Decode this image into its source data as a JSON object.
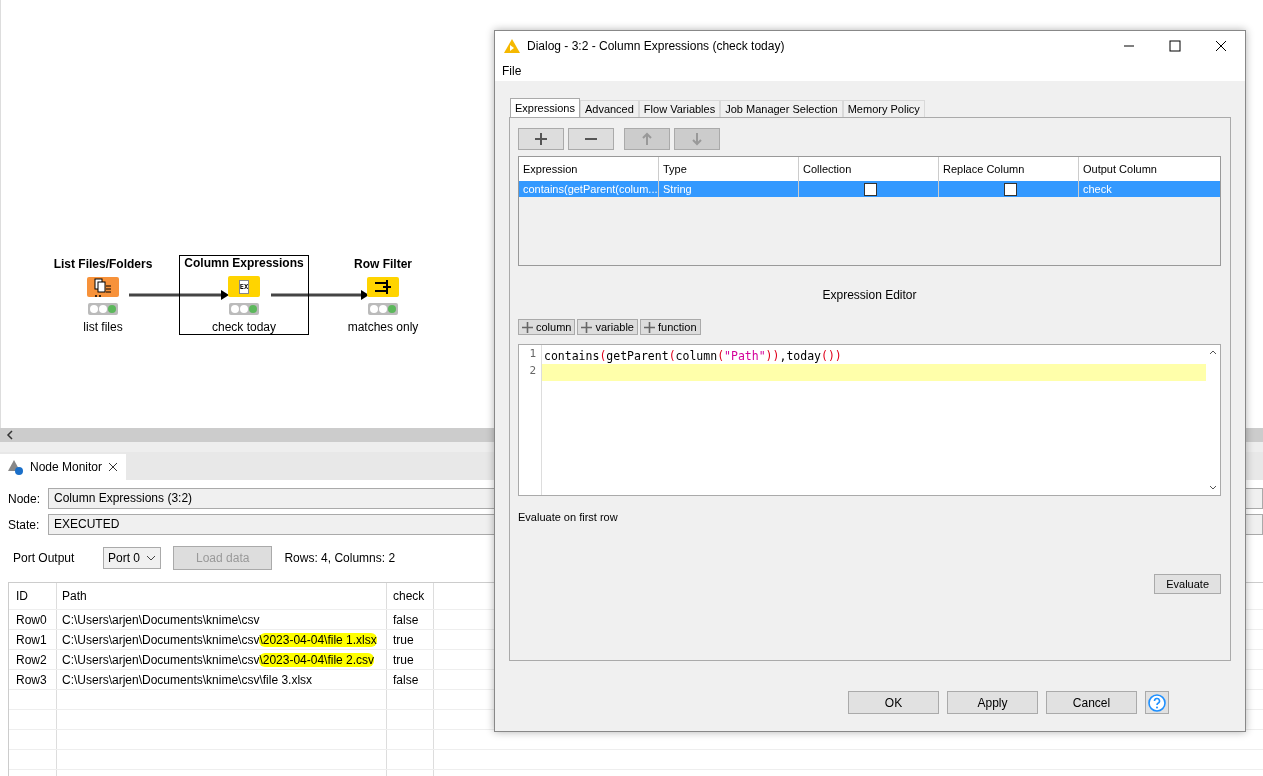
{
  "workflow": {
    "nodes": [
      {
        "title": "List Files/Folders",
        "label": "list files",
        "kind": "reader",
        "executed": true,
        "selected": false
      },
      {
        "title": "Column Expressions",
        "label": "check today",
        "kind": "manipulator",
        "executed": true,
        "selected": true,
        "badge": "EX"
      },
      {
        "title": "Row Filter",
        "label": "matches only",
        "kind": "filter",
        "executed": true,
        "selected": false
      }
    ]
  },
  "node_monitor": {
    "tab": "Node Monitor",
    "node_label": "Node:",
    "node_value": "Column Expressions  (3:2)",
    "state_label": "State:",
    "state_value": "EXECUTED",
    "port_label": "Port Output",
    "port_value": "Port 0",
    "load_button": "Load data",
    "load_disabled": true,
    "summary": "Rows: 4, Columns: 2",
    "table": {
      "columns": [
        "ID",
        "Path",
        "check"
      ],
      "rows": [
        {
          "id": "Row0",
          "path": "C:\\Users\\arjen\\Documents\\knime\\csv",
          "highlighted": "",
          "check": "false"
        },
        {
          "id": "Row1",
          "path": "C:\\Users\\arjen\\Documents\\knime\\csv",
          "highlighted": "\\2023-04-04\\file 1.xlsx",
          "check": "true"
        },
        {
          "id": "Row2",
          "path": "C:\\Users\\arjen\\Documents\\knime\\csv",
          "highlighted": "\\2023-04-04\\file 2.csv",
          "check": "true"
        },
        {
          "id": "Row3",
          "path": "C:\\Users\\arjen\\Documents\\knime\\csv\\file 3.xlsx",
          "highlighted": "",
          "check": "false"
        }
      ]
    }
  },
  "dialog": {
    "title": "Dialog - 3:2 - Column Expressions (check today)",
    "menu": [
      "File"
    ],
    "tabs": [
      {
        "label": "Expressions",
        "selected": true
      },
      {
        "label": "Advanced",
        "selected": false
      },
      {
        "label": "Flow Variables",
        "selected": false
      },
      {
        "label": "Job Manager Selection",
        "selected": false
      },
      {
        "label": "Memory Policy",
        "selected": false
      }
    ],
    "toolbar": [
      {
        "kind": "add",
        "disabled": false
      },
      {
        "kind": "remove",
        "disabled": false
      },
      {
        "kind": "up",
        "disabled": true
      },
      {
        "kind": "down",
        "disabled": true
      }
    ],
    "table": {
      "columns": [
        "Expression",
        "Type",
        "Collection",
        "Replace Column",
        "Output Column"
      ],
      "rows": [
        {
          "expression": "contains(getParent(colum...",
          "type": "String",
          "collection": false,
          "replace": false,
          "output": "check",
          "selected": true
        }
      ]
    },
    "editor_title": "Expression Editor",
    "insert_buttons": [
      "column",
      "variable",
      "function"
    ],
    "code": [
      {
        "number": "1",
        "current": false,
        "tokens": [
          {
            "kind": "text",
            "text": "contains"
          },
          {
            "kind": "paren",
            "text": "("
          },
          {
            "kind": "text",
            "text": "getParent"
          },
          {
            "kind": "paren",
            "text": "("
          },
          {
            "kind": "text",
            "text": "column"
          },
          {
            "kind": "paren",
            "text": "("
          },
          {
            "kind": "string",
            "text": "\"Path\""
          },
          {
            "kind": "paren",
            "text": "))"
          },
          {
            "kind": "text",
            "text": ",today"
          },
          {
            "kind": "paren",
            "text": "())"
          }
        ]
      },
      {
        "number": "2",
        "current": true
      }
    ],
    "evaluate_label": "Evaluate on first row",
    "evaluate_button": "Evaluate",
    "buttons": [
      "OK",
      "Apply",
      "Cancel"
    ]
  }
}
